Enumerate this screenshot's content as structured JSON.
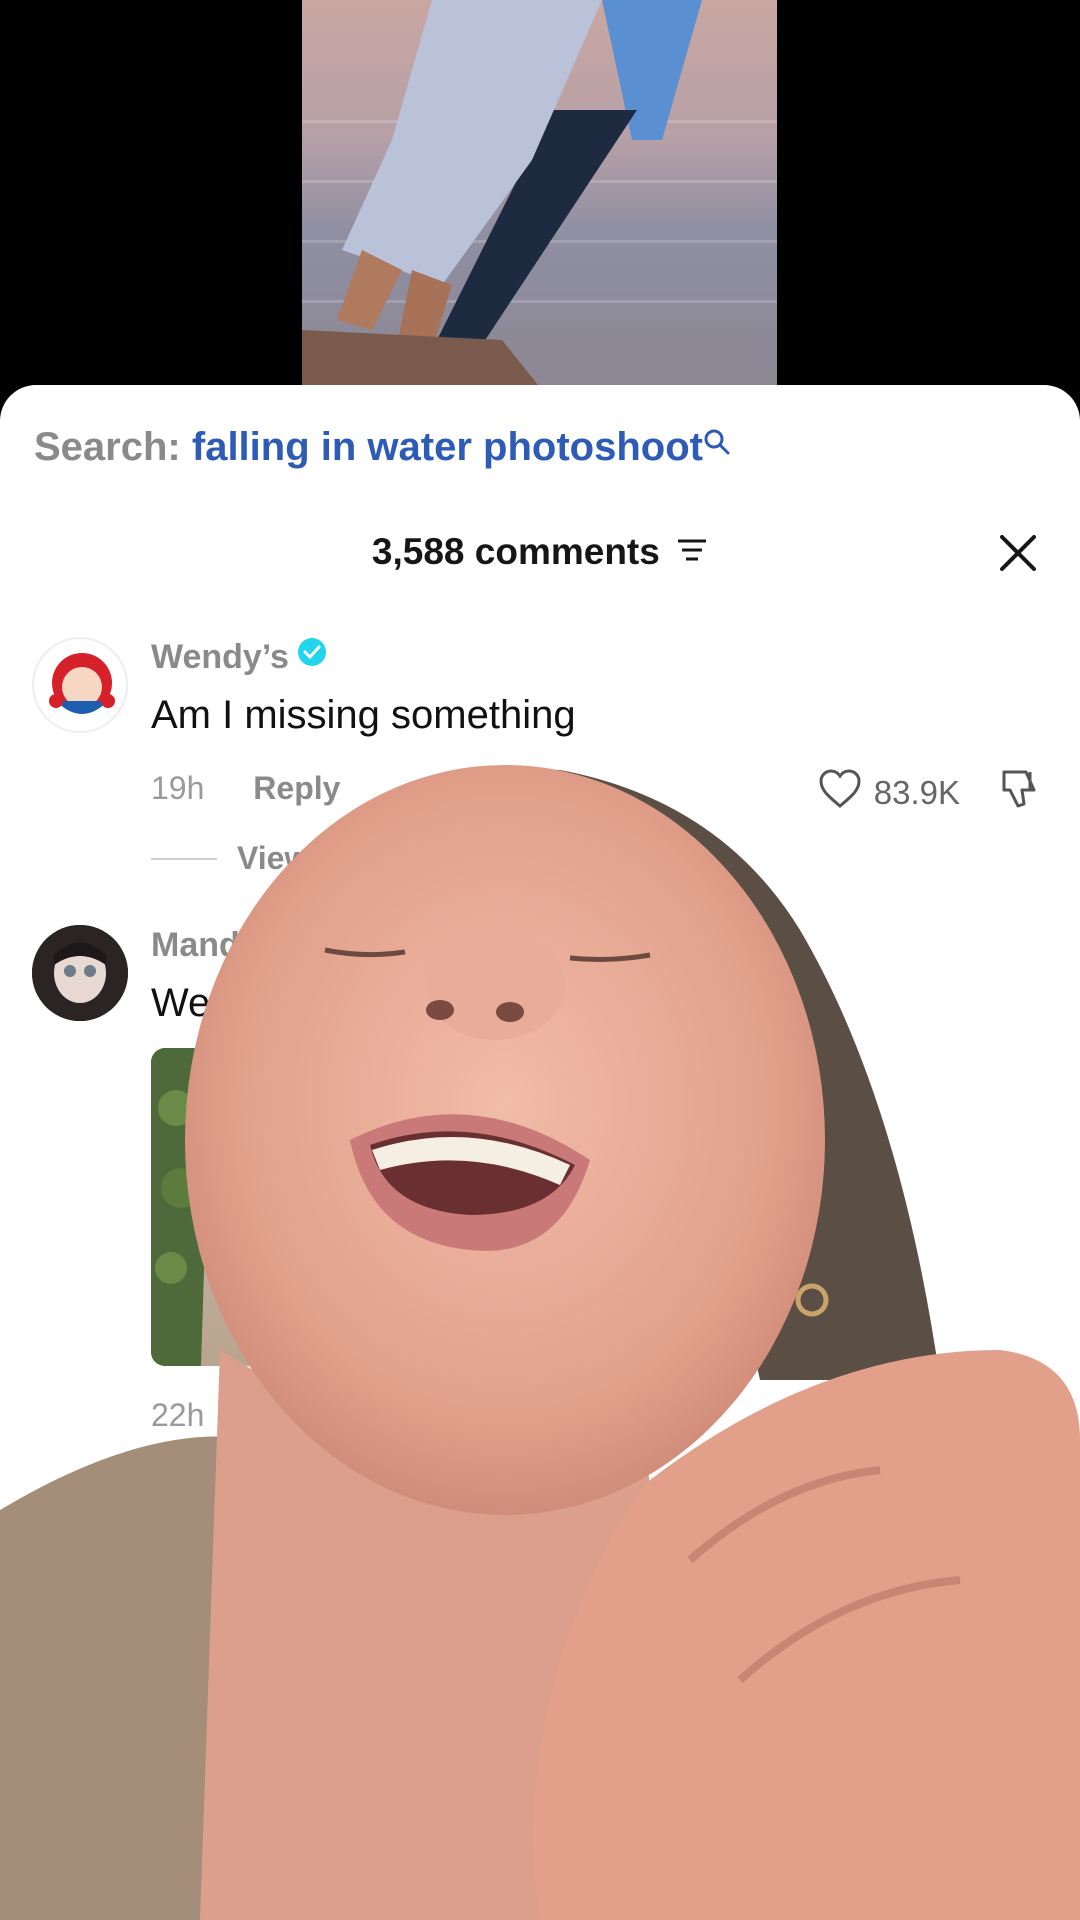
{
  "search": {
    "label": "Search:",
    "query": "falling in water photoshoot"
  },
  "comments_header": {
    "count_label": "3,588 comments"
  },
  "comments": [
    {
      "username": "Wendy’s",
      "verified": true,
      "text": "Am I missing something",
      "time": "19h",
      "reply_label": "Reply",
      "likes": "83.9K",
      "view_replies": "View"
    },
    {
      "username": "Mandi",
      "text": "Welc",
      "time": "22h"
    }
  ],
  "colors": {
    "search_query": "#2d5bb5",
    "verified_badge": "#20d5ec",
    "secondary_text": "#8a8a8a"
  }
}
